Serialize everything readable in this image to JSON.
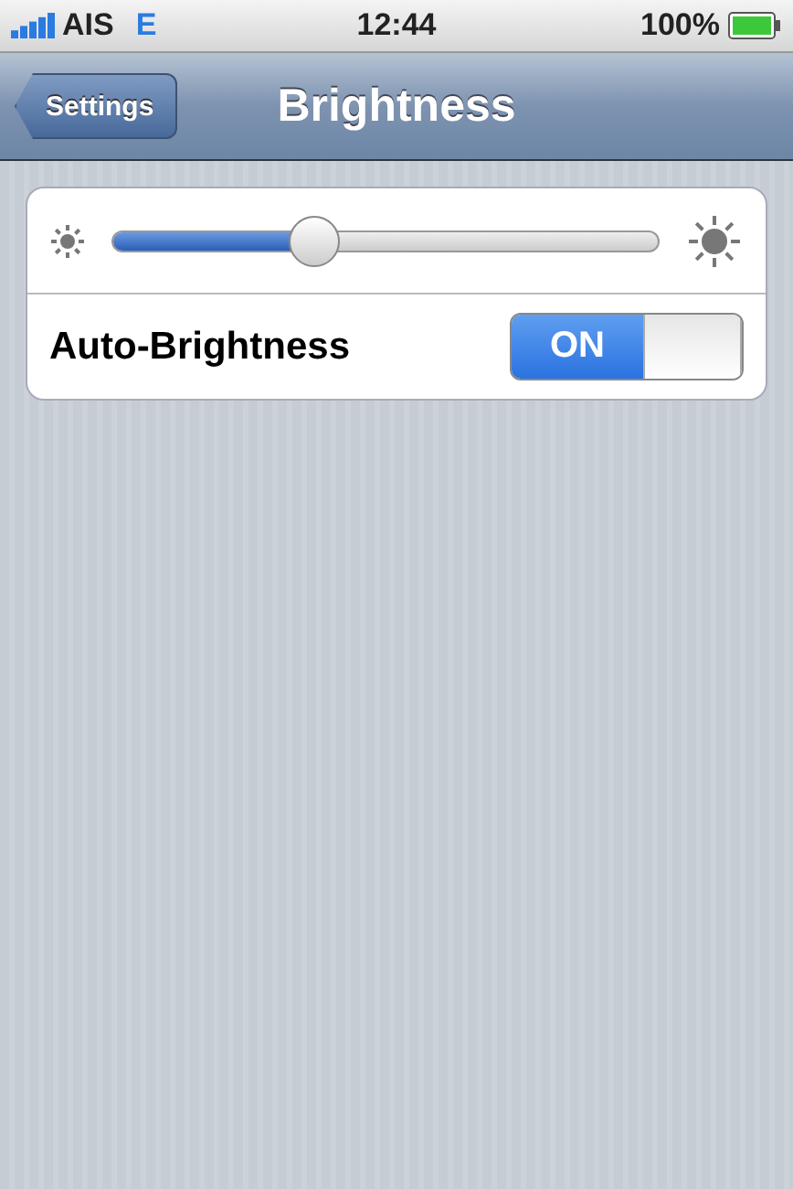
{
  "status_bar": {
    "carrier": "AIS",
    "network": "E",
    "time": "12:44",
    "battery": "100%"
  },
  "nav_bar": {
    "back_button": "Settings",
    "title": "Brightness"
  },
  "brightness": {
    "level": 0.37
  },
  "auto_brightness": {
    "label": "Auto-Brightness",
    "on": true,
    "switch_text": "ON"
  }
}
